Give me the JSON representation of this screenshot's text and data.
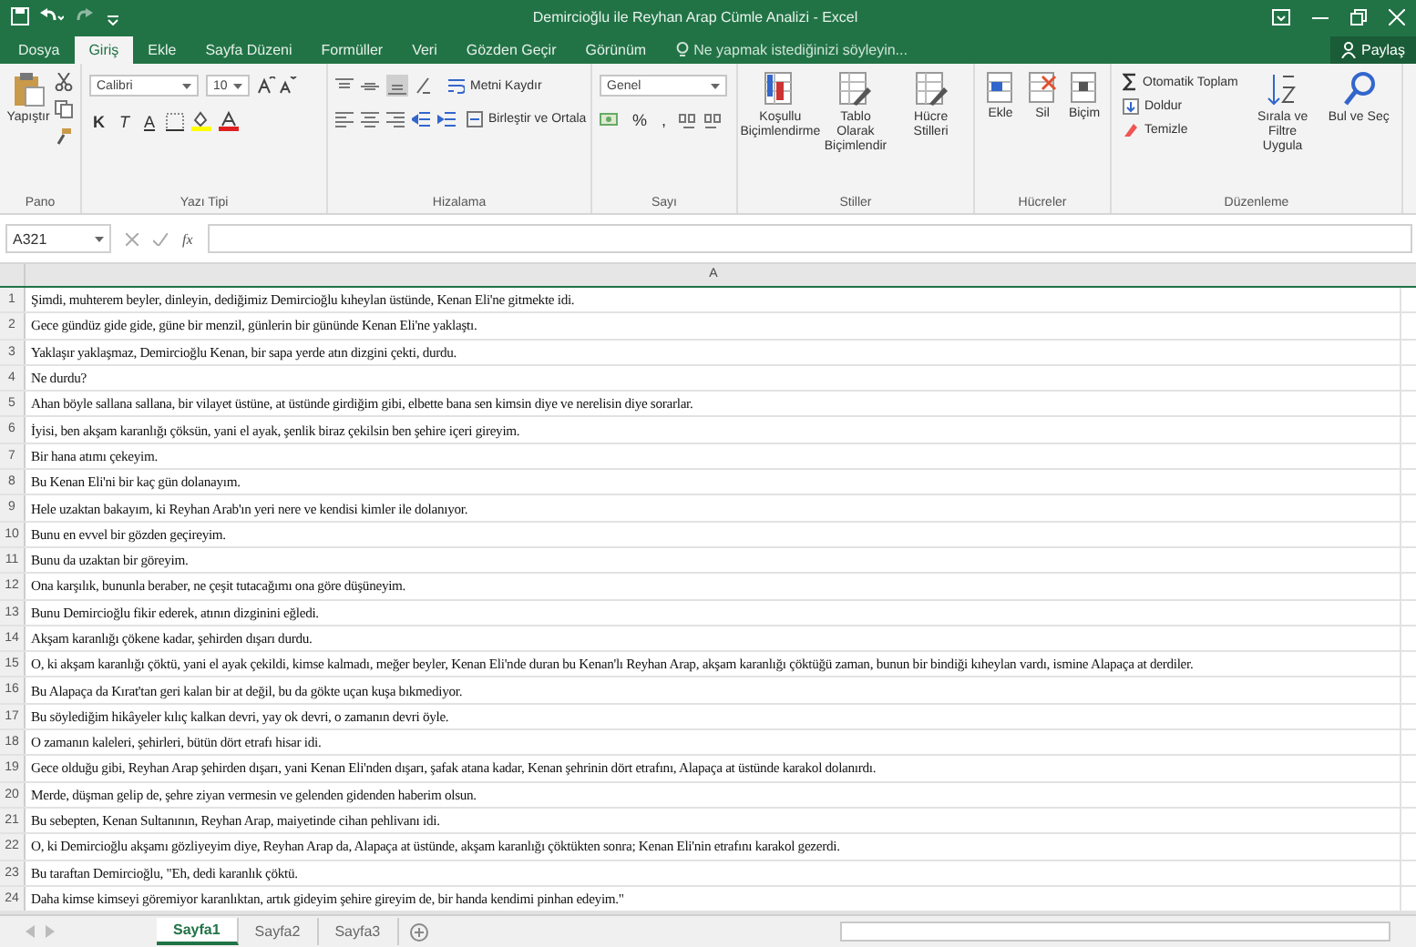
{
  "window": {
    "title": "Demircioğlu ile Reyhan Arap Cümle Analizi - Excel"
  },
  "tabs": [
    {
      "label": "Dosya",
      "selected": false
    },
    {
      "label": "Giriş",
      "selected": true
    },
    {
      "label": "Ekle",
      "selected": false
    },
    {
      "label": "Sayfa Düzeni",
      "selected": false
    },
    {
      "label": "Formüller",
      "selected": false
    },
    {
      "label": "Veri",
      "selected": false
    },
    {
      "label": "Gözden Geçir",
      "selected": false
    },
    {
      "label": "Görünüm",
      "selected": false
    }
  ],
  "tell_me": {
    "placeholder": "Ne yapmak istediğinizi söyleyin..."
  },
  "share": "Paylaş",
  "ribbon": [
    {
      "kind": "clipboard",
      "label": "Pano",
      "paste": "Yapıştır"
    },
    {
      "kind": "font",
      "label": "Yazı Tipi",
      "font": "Calibri",
      "size": "10",
      "bold": "K",
      "italic": "T",
      "underline": "A"
    },
    {
      "kind": "alignment",
      "label": "Hizalama",
      "wrap": "Metni Kaydır",
      "merge": "Birleştir ve Ortala"
    },
    {
      "kind": "number",
      "label": "Sayı",
      "format": "Genel",
      "percent": "%",
      "comma": ","
    },
    {
      "kind": "styles",
      "label": "Stiller",
      "buttons": [
        "Koşullu Biçimlendirme",
        "Tablo Olarak Biçimlendir",
        "Hücre Stilleri"
      ]
    },
    {
      "kind": "cells",
      "label": "Hücreler",
      "buttons": [
        "Ekle",
        "Sil",
        "Biçim"
      ]
    },
    {
      "kind": "editing",
      "label": "Düzenleme",
      "autosum": "Otomatik Toplam",
      "fill": "Doldur",
      "clear": "Temizle",
      "sort": "Sırala ve Filtre Uygula",
      "find": "Bul ve Seç"
    }
  ],
  "formula_bar": {
    "name_box": "A321",
    "function_label": "fx"
  },
  "sheet": {
    "column_header": "A",
    "rows": [
      {
        "number": "1",
        "text": "Şimdi, muhterem beyler, dinleyin, dediğimiz Demircioğlu kıheylan üstünde, Kenan Eli'ne gitmekte idi."
      },
      {
        "number": "2",
        "text": "Gece gündüz gide gide, güne bir menzil, günlerin bir gününde Kenan Eli'ne yaklaştı."
      },
      {
        "number": "3",
        "text": "Yaklaşır yaklaşmaz, Demircioğlu Kenan, bir sapa yerde atın dizgini çekti, durdu."
      },
      {
        "number": "4",
        "text": "Ne durdu?"
      },
      {
        "number": "5",
        "text": "Ahan böyle sallana sallana, bir vilayet üstüne, at üstünde girdiğim gibi, elbette bana sen kimsin diye ve nerelisin diye sorarlar."
      },
      {
        "number": "6",
        "text": "İyisi, ben akşam karanlığı çöksün, yani el ayak, şenlik biraz çekilsin ben şehire içeri gireyim."
      },
      {
        "number": "7",
        "text": "Bir hana atımı çekeyim."
      },
      {
        "number": "8",
        "text": "Bu Kenan Eli'ni bir kaç gün dolanayım."
      },
      {
        "number": "9",
        "text": "Hele uzaktan bakayım, ki Reyhan Arab'ın yeri nere ve kendisi kimler ile dolanıyor."
      },
      {
        "number": "10",
        "text": "Bunu en evvel bir gözden geçireyim."
      },
      {
        "number": "11",
        "text": "Bunu da uzaktan bir göreyim."
      },
      {
        "number": "12",
        "text": "Ona karşılık, bununla beraber, ne çeşit tutacağımı ona göre düşüneyim."
      },
      {
        "number": "13",
        "text": "Bunu Demircioğlu fikir ederek, atının dizginini eğledi."
      },
      {
        "number": "14",
        "text": "Akşam karanlığı çökene kadar, şehirden dışarı durdu."
      },
      {
        "number": "15",
        "text": "O, ki akşam karanlığı çöktü, yani el ayak çekildi, kimse kalmadı, meğer beyler, Kenan Eli'nde duran bu Kenan'lı Reyhan Arap, akşam karanlığı çöktüğü zaman, bunun bir bindiği kıheylan vardı, ismine Alapaça at derdiler."
      },
      {
        "number": "16",
        "text": "Bu Alapaça da Kırat'tan geri kalan bir at değil, bu da gökte uçan kuşa bıkmediyor."
      },
      {
        "number": "17",
        "text": "Bu söylediğim hikâyeler kılıç kalkan devri, yay ok devri, o zamanın devri öyle."
      },
      {
        "number": "18",
        "text": "O zamanın kaleleri, şehirleri, bütün dört etrafı hisar idi."
      },
      {
        "number": "19",
        "text": "Gece olduğu gibi, Reyhan Arap şehirden dışarı, yani Kenan Eli'nden dışarı, şafak atana kadar, Kenan şehrinin dört etrafını, Alapaça at üstünde karakol dolanırdı."
      },
      {
        "number": "20",
        "text": "Merde, düşman gelip de, şehre ziyan vermesin ve gelenden gidenden haberim olsun."
      },
      {
        "number": "21",
        "text": "Bu sebepten, Kenan Sultanının, Reyhan Arap, maiyetinde cihan pehlivanı idi."
      },
      {
        "number": "22",
        "text": "O, ki Demircioğlu akşamı gözliyeyim diye, Reyhan Arap da, Alapaça at üstünde, akşam karanlığı çöktükten sonra; Kenan Eli'nin etrafını karakol gezerdi."
      },
      {
        "number": "23",
        "text": "Bu taraftan Demircioğlu, \"Eh, dedi karanlık çöktü."
      },
      {
        "number": "24",
        "text": "Daha kimse kimseyi göremiyor karanlıktan, artık gideyim şehire gireyim de, bir handa kendimi pinhan edeyim.\""
      }
    ]
  },
  "sheet_tabs": [
    {
      "label": "Sayfa1",
      "selected": true
    },
    {
      "label": "Sayfa2",
      "selected": false
    },
    {
      "label": "Sayfa3",
      "selected": false
    }
  ]
}
